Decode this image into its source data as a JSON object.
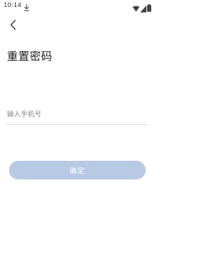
{
  "status_bar": {
    "time": "10:14",
    "icons": [
      "download-icon",
      "wifi-icon",
      "signal-icon",
      "battery-icon"
    ]
  },
  "nav": {
    "back_icon": "chevron-left-icon"
  },
  "page": {
    "title": "重置密码"
  },
  "form": {
    "phone_placeholder": "输入手机号",
    "phone_value": "",
    "confirm_label": "确定"
  },
  "colors": {
    "button_bg": "#b8c9e3",
    "button_text": "#ffffff",
    "input_border": "#dddddd",
    "placeholder": "#888888"
  }
}
